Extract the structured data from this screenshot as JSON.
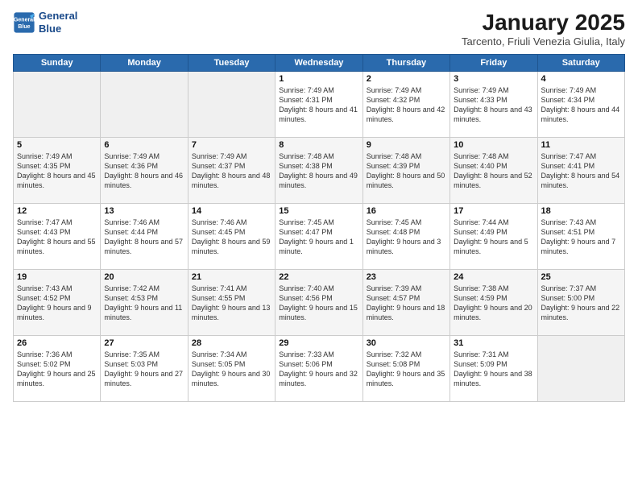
{
  "logo": {
    "line1": "General",
    "line2": "Blue"
  },
  "title": "January 2025",
  "location": "Tarcento, Friuli Venezia Giulia, Italy",
  "days_of_week": [
    "Sunday",
    "Monday",
    "Tuesday",
    "Wednesday",
    "Thursday",
    "Friday",
    "Saturday"
  ],
  "weeks": [
    [
      {
        "day": "",
        "empty": true,
        "text": ""
      },
      {
        "day": "",
        "empty": true,
        "text": ""
      },
      {
        "day": "",
        "empty": true,
        "text": ""
      },
      {
        "day": "1",
        "text": "Sunrise: 7:49 AM\nSunset: 4:31 PM\nDaylight: 8 hours and 41 minutes."
      },
      {
        "day": "2",
        "text": "Sunrise: 7:49 AM\nSunset: 4:32 PM\nDaylight: 8 hours and 42 minutes."
      },
      {
        "day": "3",
        "text": "Sunrise: 7:49 AM\nSunset: 4:33 PM\nDaylight: 8 hours and 43 minutes."
      },
      {
        "day": "4",
        "text": "Sunrise: 7:49 AM\nSunset: 4:34 PM\nDaylight: 8 hours and 44 minutes."
      }
    ],
    [
      {
        "day": "5",
        "text": "Sunrise: 7:49 AM\nSunset: 4:35 PM\nDaylight: 8 hours and 45 minutes."
      },
      {
        "day": "6",
        "text": "Sunrise: 7:49 AM\nSunset: 4:36 PM\nDaylight: 8 hours and 46 minutes."
      },
      {
        "day": "7",
        "text": "Sunrise: 7:49 AM\nSunset: 4:37 PM\nDaylight: 8 hours and 48 minutes."
      },
      {
        "day": "8",
        "text": "Sunrise: 7:48 AM\nSunset: 4:38 PM\nDaylight: 8 hours and 49 minutes."
      },
      {
        "day": "9",
        "text": "Sunrise: 7:48 AM\nSunset: 4:39 PM\nDaylight: 8 hours and 50 minutes."
      },
      {
        "day": "10",
        "text": "Sunrise: 7:48 AM\nSunset: 4:40 PM\nDaylight: 8 hours and 52 minutes."
      },
      {
        "day": "11",
        "text": "Sunrise: 7:47 AM\nSunset: 4:41 PM\nDaylight: 8 hours and 54 minutes."
      }
    ],
    [
      {
        "day": "12",
        "text": "Sunrise: 7:47 AM\nSunset: 4:43 PM\nDaylight: 8 hours and 55 minutes."
      },
      {
        "day": "13",
        "text": "Sunrise: 7:46 AM\nSunset: 4:44 PM\nDaylight: 8 hours and 57 minutes."
      },
      {
        "day": "14",
        "text": "Sunrise: 7:46 AM\nSunset: 4:45 PM\nDaylight: 8 hours and 59 minutes."
      },
      {
        "day": "15",
        "text": "Sunrise: 7:45 AM\nSunset: 4:47 PM\nDaylight: 9 hours and 1 minute."
      },
      {
        "day": "16",
        "text": "Sunrise: 7:45 AM\nSunset: 4:48 PM\nDaylight: 9 hours and 3 minutes."
      },
      {
        "day": "17",
        "text": "Sunrise: 7:44 AM\nSunset: 4:49 PM\nDaylight: 9 hours and 5 minutes."
      },
      {
        "day": "18",
        "text": "Sunrise: 7:43 AM\nSunset: 4:51 PM\nDaylight: 9 hours and 7 minutes."
      }
    ],
    [
      {
        "day": "19",
        "text": "Sunrise: 7:43 AM\nSunset: 4:52 PM\nDaylight: 9 hours and 9 minutes."
      },
      {
        "day": "20",
        "text": "Sunrise: 7:42 AM\nSunset: 4:53 PM\nDaylight: 9 hours and 11 minutes."
      },
      {
        "day": "21",
        "text": "Sunrise: 7:41 AM\nSunset: 4:55 PM\nDaylight: 9 hours and 13 minutes."
      },
      {
        "day": "22",
        "text": "Sunrise: 7:40 AM\nSunset: 4:56 PM\nDaylight: 9 hours and 15 minutes."
      },
      {
        "day": "23",
        "text": "Sunrise: 7:39 AM\nSunset: 4:57 PM\nDaylight: 9 hours and 18 minutes."
      },
      {
        "day": "24",
        "text": "Sunrise: 7:38 AM\nSunset: 4:59 PM\nDaylight: 9 hours and 20 minutes."
      },
      {
        "day": "25",
        "text": "Sunrise: 7:37 AM\nSunset: 5:00 PM\nDaylight: 9 hours and 22 minutes."
      }
    ],
    [
      {
        "day": "26",
        "text": "Sunrise: 7:36 AM\nSunset: 5:02 PM\nDaylight: 9 hours and 25 minutes."
      },
      {
        "day": "27",
        "text": "Sunrise: 7:35 AM\nSunset: 5:03 PM\nDaylight: 9 hours and 27 minutes."
      },
      {
        "day": "28",
        "text": "Sunrise: 7:34 AM\nSunset: 5:05 PM\nDaylight: 9 hours and 30 minutes."
      },
      {
        "day": "29",
        "text": "Sunrise: 7:33 AM\nSunset: 5:06 PM\nDaylight: 9 hours and 32 minutes."
      },
      {
        "day": "30",
        "text": "Sunrise: 7:32 AM\nSunset: 5:08 PM\nDaylight: 9 hours and 35 minutes."
      },
      {
        "day": "31",
        "text": "Sunrise: 7:31 AM\nSunset: 5:09 PM\nDaylight: 9 hours and 38 minutes."
      },
      {
        "day": "",
        "empty": true,
        "text": ""
      }
    ]
  ]
}
